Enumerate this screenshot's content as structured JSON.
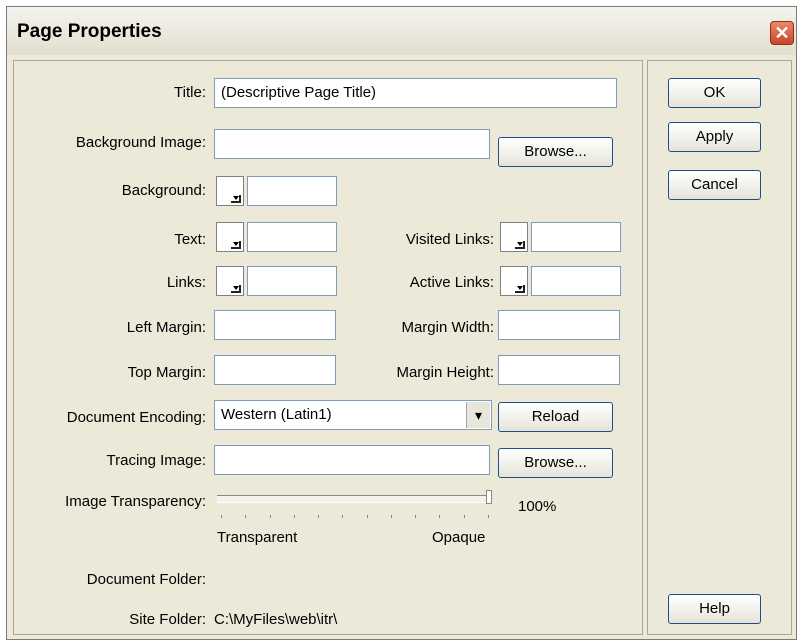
{
  "dialog": {
    "title": "Page Properties",
    "close_icon": "close-icon"
  },
  "labels": {
    "title": "Title:",
    "background_image": "Background Image:",
    "background": "Background:",
    "text": "Text:",
    "visited_links": "Visited Links:",
    "links": "Links:",
    "active_links": "Active Links:",
    "left_margin": "Left Margin:",
    "margin_width": "Margin Width:",
    "top_margin": "Top Margin:",
    "margin_height": "Margin Height:",
    "document_encoding": "Document Encoding:",
    "tracing_image": "Tracing Image:",
    "image_transparency": "Image Transparency:",
    "document_folder": "Document Folder:",
    "site_folder": "Site Folder:"
  },
  "fields": {
    "title_value": "(Descriptive Page Title)",
    "background_image_value": "",
    "background_value": "",
    "text_value": "",
    "visited_links_value": "",
    "links_value": "",
    "active_links_value": "",
    "left_margin_value": "",
    "margin_width_value": "",
    "top_margin_value": "",
    "margin_height_value": "",
    "encoding_selected": "Western (Latin1)",
    "tracing_image_value": "",
    "site_folder_value": "C:\\MyFiles\\web\\itr\\"
  },
  "slider": {
    "value_percent": 100,
    "value_label": "100%",
    "min_label": "Transparent",
    "max_label": "Opaque"
  },
  "buttons": {
    "browse_bg": "Browse...",
    "reload": "Reload",
    "browse_tracing": "Browse...",
    "ok": "OK",
    "apply": "Apply",
    "cancel": "Cancel",
    "help": "Help"
  },
  "colors": {
    "dialog_bg": "#ece9d8",
    "close_red": "#c4472b",
    "button_border": "#1c4e8a"
  }
}
